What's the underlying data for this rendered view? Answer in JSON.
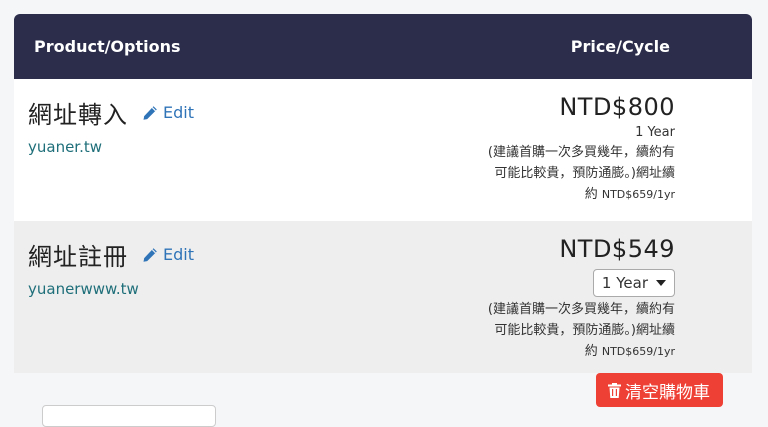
{
  "table": {
    "header": {
      "product_options": "Product/Options",
      "price_cycle": "Price/Cycle"
    },
    "rows": [
      {
        "name": "網址轉入",
        "edit_label": "Edit",
        "domain": "yuaner.tw",
        "price": "NTD$800",
        "cycle": "1 Year",
        "note_line1": "(建議首購一次多買幾年，續約有",
        "note_line2": "可能比較貴，預防通膨。)網址續",
        "note_line3_prefix": "約 ",
        "note_line3_sub": "NTD$659/1yr"
      },
      {
        "name": "網址註冊",
        "edit_label": "Edit",
        "domain": "yuanerwww.tw",
        "price": "NTD$549",
        "cycle_selected": "1 Year",
        "note_line1": "(建議首購一次多買幾年，續約有",
        "note_line2": "可能比較貴，預防通膨。)網址續",
        "note_line3_prefix": "約 ",
        "note_line3_sub": "NTD$659/1yr"
      }
    ]
  },
  "actions": {
    "empty_cart_label": "清空購物車"
  },
  "colors": {
    "header_bg": "#2b2d4b",
    "link": "#3074b8",
    "domain": "#1f6f7a",
    "danger": "#ee4034"
  },
  "icons": {
    "edit": "pencil-icon",
    "empty_cart": "trash-icon",
    "select": "caret-down-icon"
  }
}
